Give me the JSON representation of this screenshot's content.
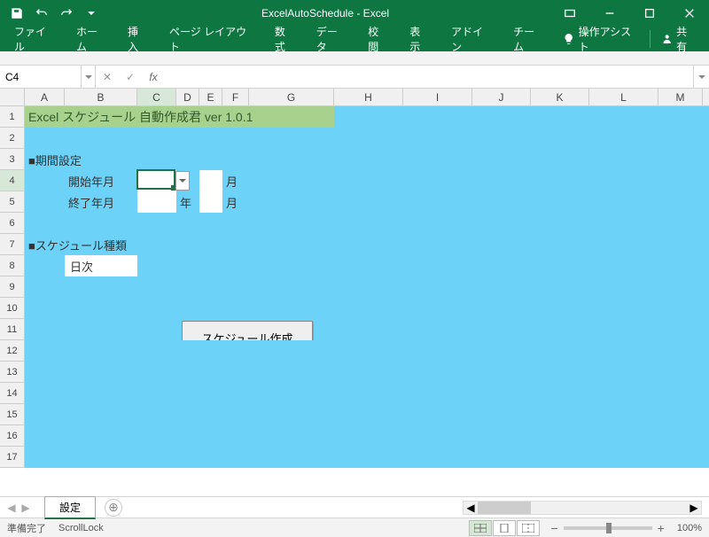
{
  "titlebar": {
    "title": "ExcelAutoSchedule - Excel"
  },
  "qat": {
    "save": "保存",
    "undo": "元に戻す",
    "redo": "やり直し"
  },
  "ribbon": {
    "tabs": [
      "ファイル",
      "ホーム",
      "挿入",
      "ページ レイアウト",
      "数式",
      "データ",
      "校閲",
      "表示",
      "アドイン",
      "チーム"
    ],
    "assist": "操作アシスト",
    "share": "共有"
  },
  "formula": {
    "name_box": "C4",
    "fx": "fx",
    "value": ""
  },
  "columns": [
    {
      "l": "A",
      "w": 45
    },
    {
      "l": "B",
      "w": 82
    },
    {
      "l": "C",
      "w": 44
    },
    {
      "l": "D",
      "w": 26
    },
    {
      "l": "E",
      "w": 26
    },
    {
      "l": "F",
      "w": 30
    },
    {
      "l": "G",
      "w": 96
    },
    {
      "l": "H",
      "w": 78
    },
    {
      "l": "I",
      "w": 78
    },
    {
      "l": "J",
      "w": 66
    },
    {
      "l": "K",
      "w": 66
    },
    {
      "l": "L",
      "w": 78
    },
    {
      "l": "M",
      "w": 50
    }
  ],
  "rows": [
    1,
    2,
    3,
    4,
    5,
    6,
    7,
    8,
    9,
    10,
    11,
    12,
    13,
    14,
    15,
    16,
    17
  ],
  "sheet": {
    "title": "Excel スケジュール 自動作成君 ver 1.0.1",
    "section1": "■期間設定",
    "start_label": "開始年月",
    "end_label": "終了年月",
    "year_suffix": "年",
    "month_suffix": "月",
    "section2": "■スケジュール種類",
    "type_value": "日次",
    "button": "スケジュール作成"
  },
  "tabs": {
    "sheet1": "設定"
  },
  "status": {
    "ready": "準備完了",
    "scroll": "ScrollLock",
    "zoom": "100%"
  }
}
